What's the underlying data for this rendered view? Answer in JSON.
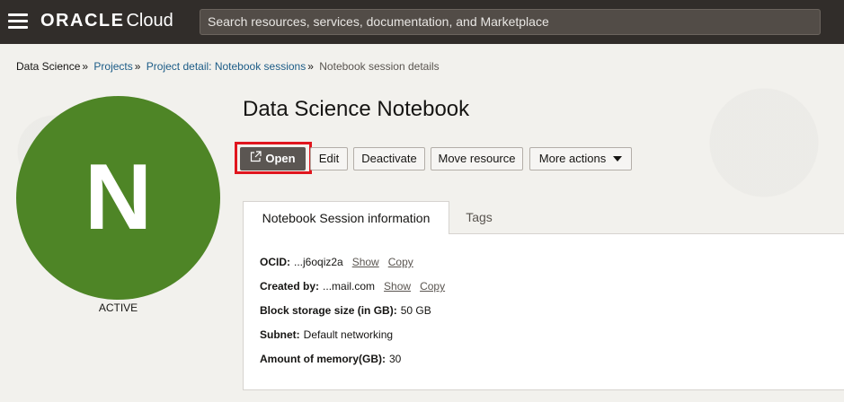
{
  "header": {
    "brand_main": "ORACLE",
    "brand_sub": "Cloud",
    "search_placeholder": "Search resources, services, documentation, and Marketplace"
  },
  "breadcrumb": {
    "items": [
      "Data Science",
      "Projects",
      "Project detail: Notebook sessions",
      "Notebook session details"
    ]
  },
  "avatar": {
    "letter": "N",
    "status": "ACTIVE",
    "color": "#4e8526"
  },
  "page": {
    "title": "Data Science Notebook"
  },
  "actions": {
    "open": "Open",
    "edit": "Edit",
    "deactivate": "Deactivate",
    "move": "Move resource",
    "more": "More actions"
  },
  "tabs": {
    "info": "Notebook Session information",
    "tags": "Tags"
  },
  "details": {
    "ocid_label": "OCID:",
    "ocid_value": "...j6oqiz2a",
    "created_label": "Created by:",
    "created_value": "...mail.com",
    "show": "Show",
    "copy": "Copy",
    "storage_label": "Block storage size (in GB):",
    "storage_value": "50 GB",
    "subnet_label": "Subnet:",
    "subnet_value": "Default networking",
    "memory_label": "Amount of memory(GB):",
    "memory_value": "30"
  },
  "colors": {
    "topbar": "#312d2a",
    "highlight": "#e0161e",
    "link": "#1c5c87"
  }
}
